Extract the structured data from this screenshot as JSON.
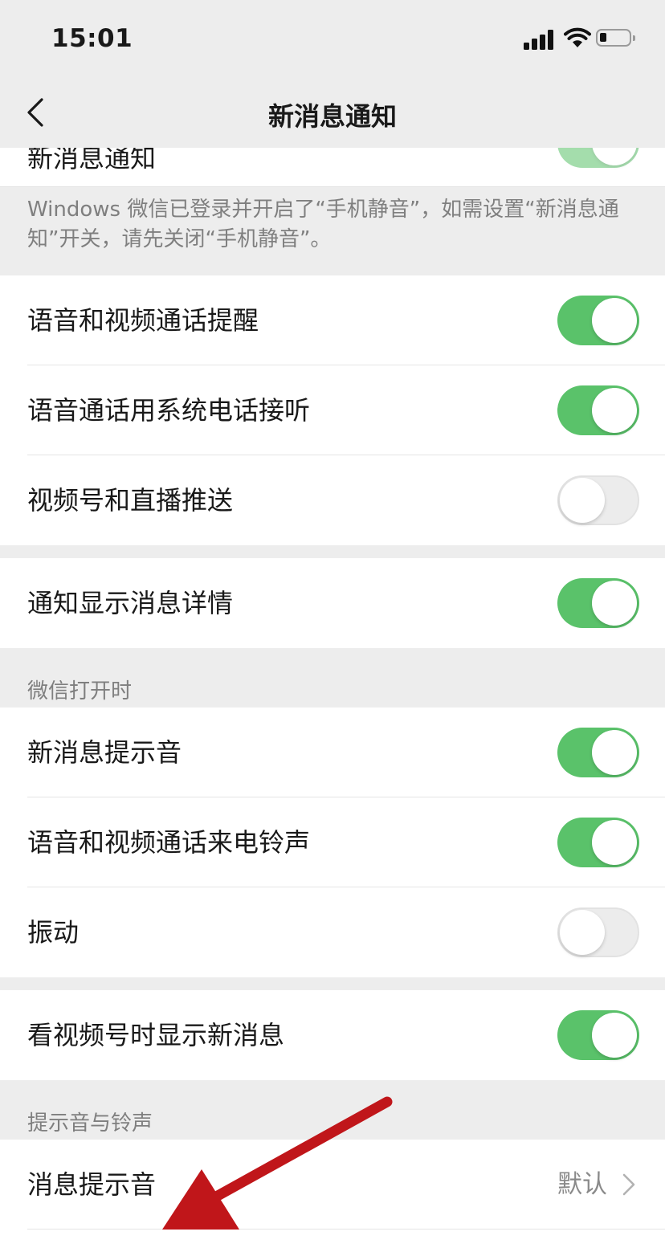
{
  "status_bar": {
    "time": "15:01"
  },
  "nav": {
    "title": "新消息通知"
  },
  "top_row": {
    "label": "新消息通知",
    "on": true
  },
  "notice": "Windows 微信已登录并开启了“手机静音”，如需设置“新消息通知”开关，请先关闭“手机静音”。",
  "group1": [
    {
      "label": "语音和视频通话提醒",
      "on": true
    },
    {
      "label": "语音通话用系统电话接听",
      "on": true
    },
    {
      "label": "视频号和直播推送",
      "on": false
    }
  ],
  "group2": [
    {
      "label": "通知显示消息详情",
      "on": true
    }
  ],
  "section_wechat_open": "微信打开时",
  "group3": [
    {
      "label": "新消息提示音",
      "on": true
    },
    {
      "label": "语音和视频通话来电铃声",
      "on": true
    },
    {
      "label": "振动",
      "on": false
    }
  ],
  "group4": [
    {
      "label": "看视频号时显示新消息",
      "on": true
    }
  ],
  "section_sounds": "提示音与铃声",
  "group5": [
    {
      "label": "消息提示音",
      "value": "默认"
    }
  ],
  "colors": {
    "accent_green": "#5ac26a",
    "annotation_arrow": "#c0161a"
  }
}
